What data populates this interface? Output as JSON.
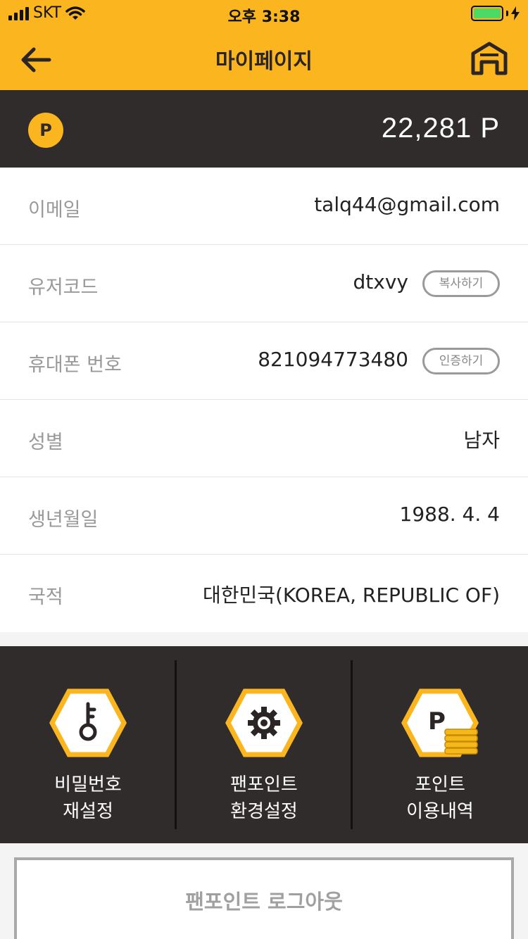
{
  "status_bar": {
    "carrier": "SKT",
    "time": "오후 3:38"
  },
  "header": {
    "title": "마이페이지"
  },
  "points": {
    "badge": "P",
    "value": "22,281 P"
  },
  "info_rows": [
    {
      "label": "이메일",
      "value": "talq44@gmail.com"
    },
    {
      "label": "유저코드",
      "value": "dtxvy",
      "button": "복사하기"
    },
    {
      "label": "휴대폰 번호",
      "value": "821094773480",
      "button": "인증하기"
    },
    {
      "label": "성별",
      "value": "남자"
    },
    {
      "label": "생년월일",
      "value": "1988. 4. 4"
    },
    {
      "label": "국적",
      "value": "대한민국(KOREA, REPUBLIC OF)"
    }
  ],
  "menu": [
    {
      "line1": "비밀번호",
      "line2": "재설정",
      "icon": "key-icon"
    },
    {
      "line1": "팬포인트",
      "line2": "환경설정",
      "icon": "gear-icon"
    },
    {
      "line1": "포인트",
      "line2": "이용내역",
      "icon": "points-coins-icon"
    }
  ],
  "logout": {
    "label": "팬포인트 로그아웃"
  },
  "colors": {
    "accent": "#fbb51f",
    "dark": "#302c2c"
  }
}
